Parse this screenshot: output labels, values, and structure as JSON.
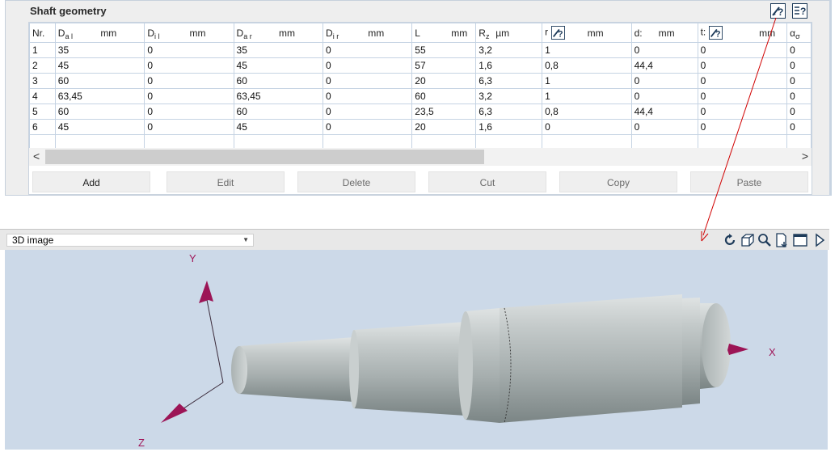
{
  "geometry": {
    "title": "Shaft geometry",
    "columns": {
      "nr": "Nr.",
      "dal": {
        "sym": "D",
        "sub": "a l",
        "unit": "mm"
      },
      "dil": {
        "sym": "D",
        "sub": "i l",
        "unit": "mm"
      },
      "dar": {
        "sym": "D",
        "sub": "a r",
        "unit": "mm"
      },
      "dir": {
        "sym": "D",
        "sub": "i r",
        "unit": "mm"
      },
      "l": {
        "sym": "L",
        "unit": "mm"
      },
      "rz": {
        "sym": "R",
        "sub": "z",
        "unit": "µm"
      },
      "r": {
        "sym": "r",
        "unit": "mm"
      },
      "d": {
        "sym": "d:",
        "unit": "mm"
      },
      "t": {
        "sym": "t:",
        "unit": "mm"
      },
      "alpha": {
        "sym": "α",
        "sub": "σ"
      }
    },
    "rows": [
      [
        "1",
        "35",
        "0",
        "35",
        "0",
        "55",
        "3,2",
        "1",
        "0",
        "0",
        "0"
      ],
      [
        "2",
        "45",
        "0",
        "45",
        "0",
        "57",
        "1,6",
        "0,8",
        "44,4",
        "0",
        "0"
      ],
      [
        "3",
        "60",
        "0",
        "60",
        "0",
        "20",
        "6,3",
        "1",
        "0",
        "0",
        "0"
      ],
      [
        "4",
        "63,45",
        "0",
        "63,45",
        "0",
        "60",
        "3,2",
        "1",
        "0",
        "0",
        "0"
      ],
      [
        "5",
        "60",
        "0",
        "60",
        "0",
        "23,5",
        "6,3",
        "0,8",
        "44,4",
        "0",
        "0"
      ],
      [
        "6",
        "45",
        "0",
        "45",
        "0",
        "20",
        "1,6",
        "0",
        "0",
        "0",
        "0"
      ],
      [
        "",
        "",
        "",
        "",
        "",
        "",
        "",
        "",
        "",
        "",
        ""
      ]
    ],
    "scroll": {
      "left": "<",
      "right": ">"
    },
    "buttons": {
      "add": "Add",
      "edit": "Edit",
      "delete": "Delete",
      "cut": "Cut",
      "copy": "Copy",
      "paste": "Paste"
    }
  },
  "view3d": {
    "select_value": "3D image",
    "axes": {
      "x": "X",
      "y": "Y",
      "z": "Z"
    },
    "icons": [
      "rotate-icon",
      "cube-view-icon",
      "zoom-icon",
      "export-icon",
      "window-icon",
      "play-icon"
    ]
  },
  "colors": {
    "axis": "#a0185a",
    "shaft": "#b5bcbc",
    "viewport_bg": "#ccd9e8",
    "arrow": "#d10000"
  }
}
